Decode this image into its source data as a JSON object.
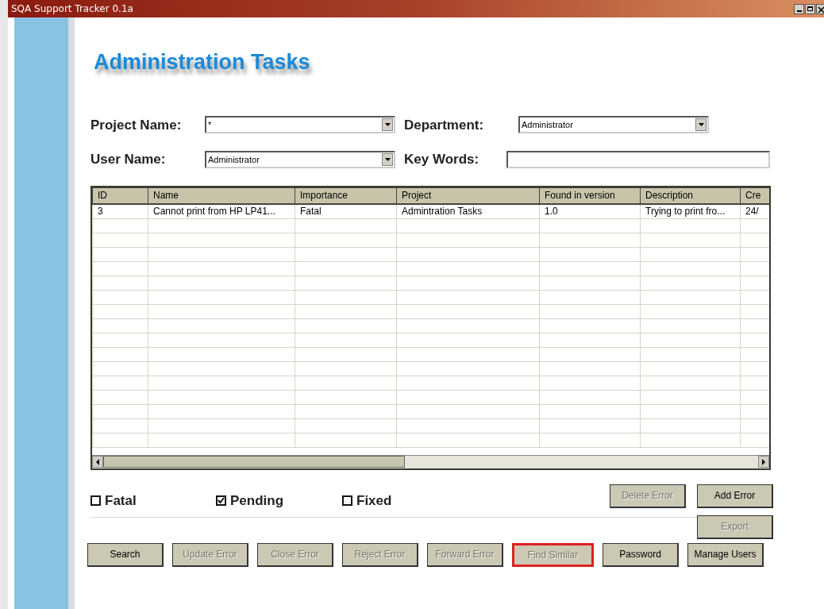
{
  "window": {
    "title": "SQA Support Tracker 0.1a"
  },
  "heading": "Administration Tasks",
  "filters": [
    {
      "label": "Project Name:",
      "kind": "dropdown",
      "value": "*"
    },
    {
      "label": "Department:",
      "kind": "dropdown",
      "value": "Administrator"
    },
    {
      "label": "User Name:",
      "kind": "dropdown",
      "value": "Administrator"
    },
    {
      "label": "Key Words:",
      "kind": "text"
    }
  ],
  "table": {
    "columns": [
      "ID",
      "Name",
      "Importance",
      "Project",
      "Found in version",
      "Description",
      "Cre"
    ],
    "rows": [
      [
        "3",
        "Cannot print from HP LP41...",
        "Fatal",
        "Admintration Tasks",
        "1.0",
        "Trying to print fro...",
        "24/"
      ]
    ]
  },
  "checkboxes": [
    {
      "label": "Fatal",
      "checked": false
    },
    {
      "label": "Pending",
      "checked": true
    },
    {
      "label": "Fixed",
      "checked": false
    }
  ],
  "side_buttons": [
    {
      "label": "Delete Error",
      "disabled": true,
      "focused": false
    },
    {
      "label": "Add Error",
      "disabled": false,
      "focused": false
    },
    {
      "label": "Export",
      "disabled": true,
      "focused": false
    }
  ],
  "buttons": [
    {
      "label": "Search",
      "disabled": false,
      "focused": false
    },
    {
      "label": "Update Error",
      "disabled": true,
      "focused": false
    },
    {
      "label": "Close Error",
      "disabled": true,
      "focused": false
    },
    {
      "label": "Reject Error",
      "disabled": true,
      "focused": false
    },
    {
      "label": "Forward Error",
      "disabled": true,
      "focused": false
    },
    {
      "label": "Find Similar",
      "disabled": true,
      "focused": true
    },
    {
      "label": "Password",
      "disabled": false,
      "focused": false
    },
    {
      "label": "Manage Users",
      "disabled": false,
      "focused": false
    }
  ]
}
